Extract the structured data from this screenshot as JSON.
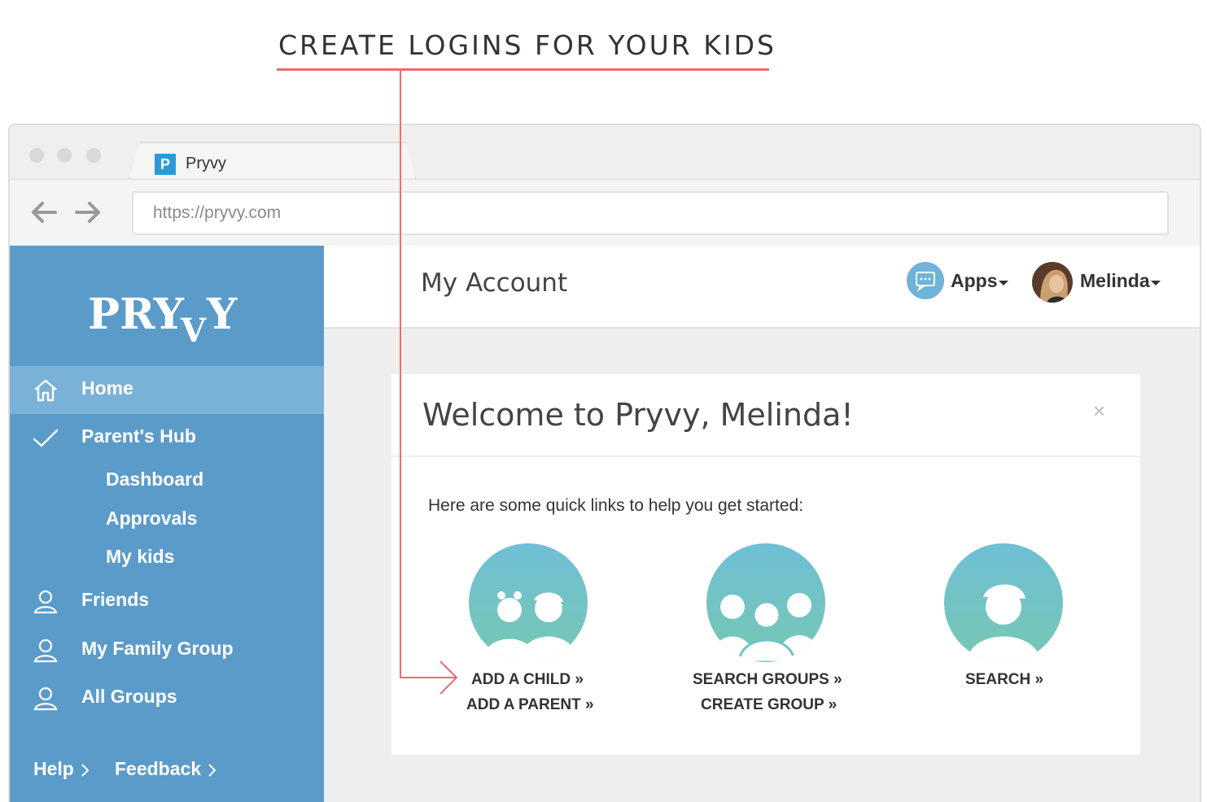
{
  "callout": {
    "text": "CREATE LOGINS FOR YOUR KIDS"
  },
  "browser": {
    "tab_favicon": "P",
    "tab_title": "Pryvy",
    "url": "https://pryvy.com",
    "icons": [
      "back-arrow-icon",
      "forward-arrow-icon"
    ]
  },
  "sidebar": {
    "logo": "PRYVY",
    "items": [
      {
        "label": "Home",
        "icon": "house-icon",
        "active": true
      },
      {
        "label": "Parent's Hub",
        "icon": "checkmark-icon"
      },
      {
        "label": "Friends",
        "icon": "person-icon"
      },
      {
        "label": "My Family Group",
        "icon": "person-icon"
      },
      {
        "label": "All Groups",
        "icon": "person-icon"
      }
    ],
    "sub_items": [
      "Dashboard",
      "Approvals",
      "My kids"
    ],
    "footer": [
      {
        "label": "Help",
        "icon": "chevron-right-icon"
      },
      {
        "label": "Feedback",
        "icon": "chevron-right-icon"
      }
    ]
  },
  "header": {
    "title": "My Account",
    "apps_label": "Apps",
    "apps_icon": "chat-bubble-icon",
    "user_name": "Melinda"
  },
  "welcome": {
    "title": "Welcome to Pryvy, Melinda!",
    "close": "×",
    "subtitle": "Here are some quick links to help you get started:",
    "groups": [
      {
        "icon": "children-icon",
        "links": [
          "ADD A CHILD »",
          "ADD A PARENT »"
        ]
      },
      {
        "icon": "group-icon",
        "links": [
          "SEARCH GROUPS »",
          "CREATE GROUP »"
        ]
      },
      {
        "icon": "single-person-icon",
        "links": [
          "SEARCH »"
        ]
      }
    ]
  },
  "colors": {
    "sidebar": "#5b9bc9",
    "sidebar_active": "#7ab1d6",
    "accent_red": "#ec6b6e",
    "teal_gradient": [
      "#6fbfd6",
      "#76c8b2"
    ]
  }
}
